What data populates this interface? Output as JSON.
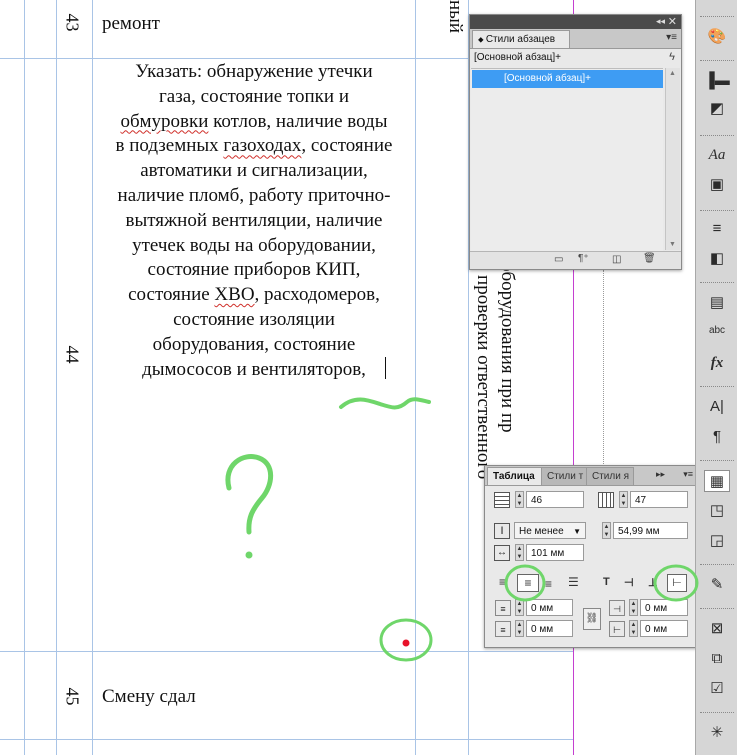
{
  "document": {
    "rows": [
      {
        "number": "43",
        "text": "ремонт"
      },
      {
        "number": "44",
        "lines": [
          {
            "plain": "Указать: обнаружение утечки"
          },
          {
            "plain": "газа, состояние топки и"
          },
          {
            "squig": "обмуровки",
            "plain": " котлов, наличие воды"
          },
          {
            "plain": "в подземных ",
            "squig": "газоходах",
            "tail": ", состояние"
          },
          {
            "plain": "автоматики и сигнализации,"
          },
          {
            "plain": "наличие пломб, работу приточно-"
          },
          {
            "plain": "вытяжной вентиляции, наличие"
          },
          {
            "plain": "утечек воды на оборудовании,"
          },
          {
            "plain": "состояние приборов КИП,"
          },
          {
            "plain": "состояние ",
            "squig": "ХВО",
            "tail": ", расходомеров,"
          },
          {
            "plain": "состояние изоляции"
          },
          {
            "plain": "оборудования, состояние"
          },
          {
            "plain": "дымососов и вентиляторов,"
          }
        ]
      },
      {
        "number": "45",
        "text": "Смену сдал"
      }
    ],
    "rotated_top": "ный",
    "rotated_line1": "оборудования при пр",
    "rotated_line2": "т проверки ответственного"
  },
  "paragraph_styles_panel": {
    "tab_label": "Стили абзацев",
    "current_style": "[Основной абзац]+",
    "selected_item": "[Основной абзац]+"
  },
  "table_panel": {
    "tabs": [
      "Таблица",
      "Стили т",
      "Стили я"
    ],
    "rows_value": "46",
    "columns_value": "47",
    "row_height_mode": "Не менее",
    "row_height_value": "54,99 мм",
    "column_width_value": "101 мм",
    "inset_top": "0 мм",
    "inset_bottom": "0 мм",
    "inset_left": "0 мм",
    "inset_right": "0 мм"
  },
  "colors": {
    "selection_blue": "#3e9cf3",
    "annotation_green": "#6fd66a",
    "annotation_red": "#e8122a",
    "grid_blue": "#a9c4e6",
    "guide_magenta": "#c43fd0"
  }
}
